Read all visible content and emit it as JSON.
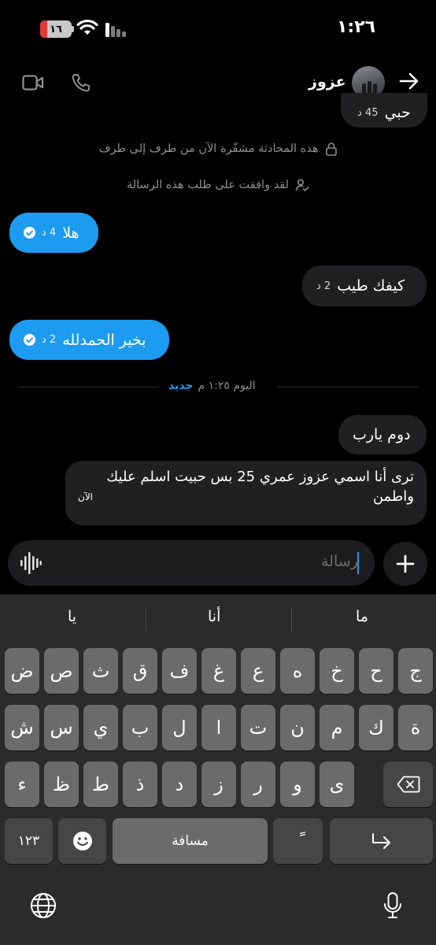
{
  "status_bar": {
    "time": "١:٢٦",
    "battery": "١٦"
  },
  "header": {
    "contact_name": "عزوز"
  },
  "messages": {
    "partial": {
      "text": "حبي",
      "time": "45 د"
    },
    "system_encrypted": "هذه المحادثة مشفّرة الآن من طرف إلى طرف",
    "system_accepted": "لقد وافقت على طلب هذه الرسالة",
    "m1": {
      "text": "هلا",
      "time": "4 د"
    },
    "m2": {
      "text": "كيفك طيب",
      "time": "2 د"
    },
    "m3": {
      "text": "بخير الحمدلله",
      "time": "2 د"
    },
    "divider": {
      "label": "اليوم ١:٢٥ م",
      "new": "جديد"
    },
    "m4": {
      "text": "دوم يارب"
    },
    "m5": {
      "line1": "ترى أنا اسمي عزوز عمري 25 بس حبيت اسلم عليك",
      "line2": "واطمن",
      "time": "الآن"
    }
  },
  "composer": {
    "placeholder": "رسالة"
  },
  "keyboard": {
    "suggestions": [
      "ما",
      "أنا",
      "يا"
    ],
    "row1": [
      "ج",
      "ح",
      "خ",
      "ه",
      "ع",
      "غ",
      "ف",
      "ق",
      "ث",
      "ص",
      "ض"
    ],
    "row2": [
      "ة",
      "ك",
      "م",
      "ن",
      "ت",
      "ا",
      "ل",
      "ب",
      "ي",
      "س",
      "ش"
    ],
    "row3": [
      "ى",
      "و",
      "ر",
      "ز",
      "د",
      "ذ",
      "ط",
      "ظ",
      "ء"
    ],
    "numbers_key": "١٢٣",
    "space_key": "مسافة",
    "diacritic_key": "ً"
  },
  "colors": {
    "accent": "#1d9bf0",
    "incoming_bubble": "#202022",
    "background": "#000000"
  }
}
